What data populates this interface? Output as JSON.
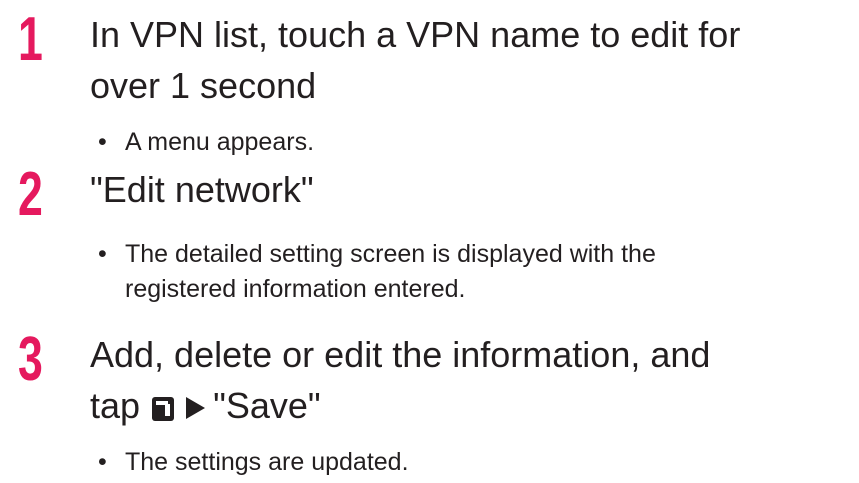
{
  "steps": [
    {
      "number": "1",
      "lines": [
        "In VPN list, touch a VPN name to edit for",
        "over 1 second"
      ],
      "bullets": [
        {
          "dot": "•",
          "text": "A menu appears."
        }
      ]
    },
    {
      "number": "2",
      "lines": [
        "\"Edit network\""
      ],
      "bullets": [
        {
          "dot": "•",
          "text": "The detailed setting screen is displayed with the",
          "cont": "registered information entered."
        }
      ]
    },
    {
      "number": "3",
      "lines": [
        "Add, delete or edit the information, and"
      ],
      "line2_prefix": "tap",
      "line2_suffix": "\"Save\"",
      "icons": [
        "menu-key-icon",
        "arrow-right-icon"
      ],
      "bullets": [
        {
          "dot": "•",
          "text": "The settings are updated."
        }
      ]
    }
  ],
  "colors": {
    "step_number": "#e5195e",
    "text": "#231f20"
  }
}
